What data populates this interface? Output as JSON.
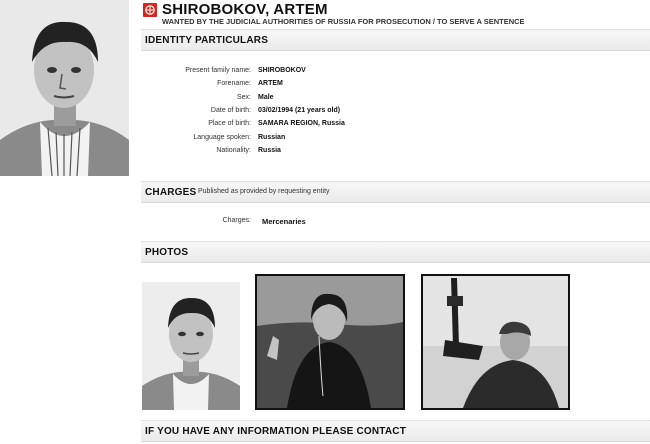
{
  "notice": {
    "name": "SHIROBOKOV, ARTEM",
    "subtitle": "WANTED BY THE JUDICIAL AUTHORITIES OF RUSSIA FOR PROSECUTION / TO SERVE A SENTENCE",
    "logo_color": "#d8231e"
  },
  "identity": {
    "title": "IDENTITY PARTICULARS",
    "fields": [
      {
        "label": "Present family name:",
        "value": "SHIROBOKOV"
      },
      {
        "label": "Forename:",
        "value": "ARTEM"
      },
      {
        "label": "Sex:",
        "value": "Male"
      },
      {
        "label": "Date of birth:",
        "value": "03/02/1994 (21 years old)"
      },
      {
        "label": "Place of birth:",
        "value": "SAMARA REGION, Russia"
      },
      {
        "label": "Language spoken:",
        "value": "Russian"
      },
      {
        "label": "Nationality:",
        "value": "Russia"
      }
    ]
  },
  "charges": {
    "title": "CHARGES",
    "note": "Published as provided by requesting entity",
    "label": "Charges:",
    "value": "Mercenaries"
  },
  "photos": {
    "title": "PHOTOS"
  },
  "contact": {
    "title": "IF YOU HAVE ANY INFORMATION PLEASE CONTACT"
  }
}
